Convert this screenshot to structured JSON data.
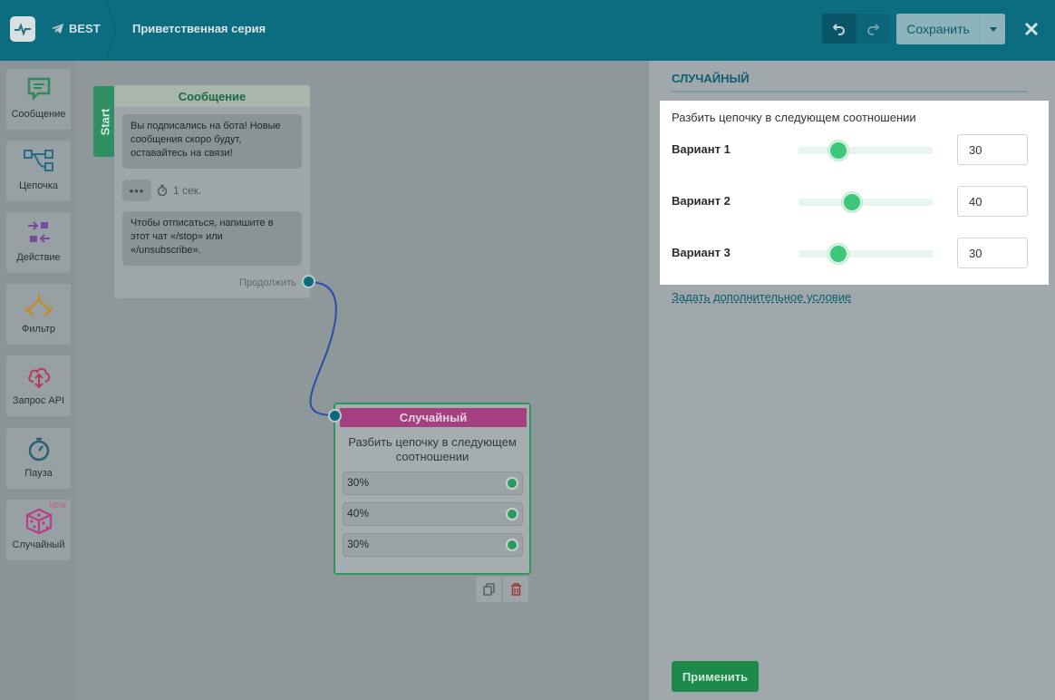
{
  "header": {
    "bot_name": "BEST",
    "flow_title": "Приветственная серия",
    "save_label": "Сохранить"
  },
  "toolbar": {
    "items": [
      {
        "label": "Сообщение",
        "icon": "message-icon",
        "color": "#2d8a5b"
      },
      {
        "label": "Цепочка",
        "icon": "chain-icon",
        "color": "#2c6a8c"
      },
      {
        "label": "Действие",
        "icon": "action-icon",
        "color": "#7a4a9e"
      },
      {
        "label": "Фильтр",
        "icon": "filter-icon",
        "color": "#c98a1e"
      },
      {
        "label": "Запрос API",
        "icon": "api-icon",
        "color": "#b83a5a"
      },
      {
        "label": "Пауза",
        "icon": "pause-icon",
        "color": "#2c5f78"
      },
      {
        "label": "Случайный",
        "icon": "dice-icon",
        "color": "#b83f87",
        "badge": "NEW"
      }
    ]
  },
  "canvas": {
    "start_label": "Start",
    "message_node": {
      "title": "Сообщение",
      "bubble1": "Вы подписались на бота! Новые сообщения скоро будут, оставайтесь на связи!",
      "delay_dots": "•••",
      "delay_text": "1 сек.",
      "bubble2": "Чтобы отписаться, напишите в этот чат «/stop» или «/unsubscribe».",
      "continue_label": "Продолжить"
    },
    "random_node": {
      "title": "Случайный",
      "description": "Разбить цепочку в следующем соотношении",
      "rows": [
        "30%",
        "40%",
        "30%"
      ]
    }
  },
  "panel": {
    "title": "СЛУЧАЙНЫЙ",
    "description": "Разбить цепочку в следующем соотношении",
    "variants": [
      {
        "label": "Вариант 1",
        "value": "30",
        "slider_fraction": 0.3
      },
      {
        "label": "Вариант 2",
        "value": "40",
        "slider_fraction": 0.4
      },
      {
        "label": "Вариант 3",
        "value": "30",
        "slider_fraction": 0.3
      }
    ],
    "add_condition": "Задать дополнительное условие",
    "apply_label": "Применить"
  },
  "colors": {
    "header": "#0c6c80",
    "accent_green": "#3cc77a",
    "random_node": "#a54080"
  }
}
